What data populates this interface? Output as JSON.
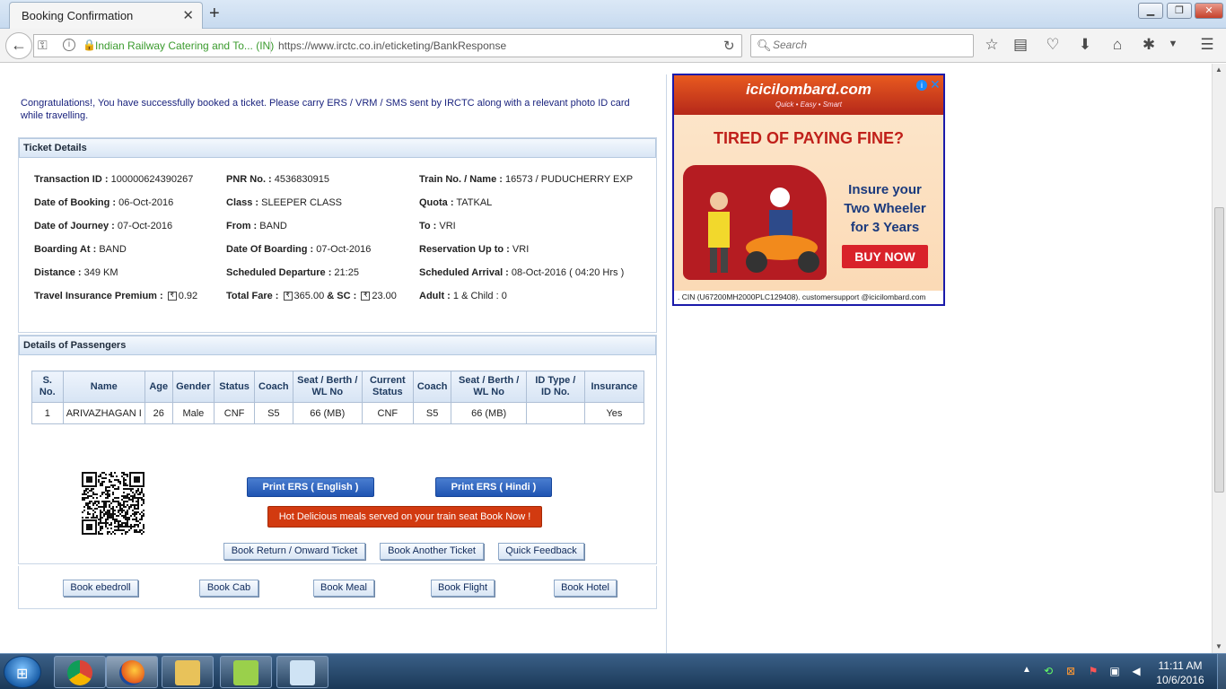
{
  "browser": {
    "tab_title": "Booking Confirmation",
    "site_identity": "Indian Railway Catering and To... (IN)",
    "url": "https://www.irctc.co.in/eticketing/BankResponse",
    "search_placeholder": "Search"
  },
  "page": {
    "congrats_message": "Congratulations!, You have successfully booked a ticket. Please carry ERS / VRM / SMS sent by IRCTC along with a relevant photo ID card while travelling.",
    "ticket_section_title": "Ticket Details",
    "passengers_section_title": "Details of Passengers"
  },
  "ticket": {
    "transaction_id_label": "Transaction ID :",
    "transaction_id": "100000624390267",
    "pnr_label": "PNR No. :",
    "pnr": "4536830915",
    "train_label": "Train No. / Name :",
    "train": "16573 / PUDUCHERRY EXP",
    "booking_date_label": "Date of Booking :",
    "booking_date": "06-Oct-2016",
    "class_label": "Class :",
    "class": "SLEEPER CLASS",
    "quota_label": "Quota :",
    "quota": "TATKAL",
    "journey_date_label": "Date of Journey :",
    "journey_date": "07-Oct-2016",
    "from_label": "From :",
    "from": "BAND",
    "to_label": "To :",
    "to": "VRI",
    "boarding_at_label": "Boarding At :",
    "boarding_at": "BAND",
    "boarding_date_label": "Date Of Boarding :",
    "boarding_date": "07-Oct-2016",
    "reservation_upto_label": "Reservation Up to :",
    "reservation_upto": "VRI",
    "distance_label": "Distance :",
    "distance": "349 KM",
    "sched_departure_label": "Scheduled Departure :",
    "sched_departure": "21:25",
    "sched_arrival_label": "Scheduled Arrival :",
    "sched_arrival": "08-Oct-2016 ( 04:20 Hrs )",
    "insurance_label": "Travel Insurance Premium :",
    "insurance": "0.92",
    "fare_label": "Total Fare :",
    "fare": "365.00",
    "sc_label": "& SC :",
    "sc": "23.00",
    "pax_count_label": "Adult :",
    "pax_count": "1 & Child : 0"
  },
  "passenger_table": {
    "headers": [
      "S. No.",
      "Name",
      "Age",
      "Gender",
      "Status",
      "Coach",
      "Seat / Berth / WL No",
      "Current Status",
      "Coach",
      "Seat / Berth / WL No",
      "ID Type / ID No.",
      "Insurance"
    ],
    "rows": [
      [
        "1",
        "ARIVAZHAGAN I",
        "26",
        "Male",
        "CNF",
        "S5",
        "66 (MB)",
        "CNF",
        "S5",
        "66 (MB)",
        "",
        "Yes"
      ]
    ]
  },
  "actions": {
    "print_english": "Print ERS ( English )",
    "print_hindi": "Print ERS ( Hindi )",
    "meal_promo": "Hot Delicious meals served on your train seat Book Now !",
    "book_return": "Book Return / Onward Ticket",
    "book_another": "Book Another Ticket",
    "quick_feedback": "Quick Feedback",
    "book_ebedroll": "Book ebedroll",
    "book_cab": "Book Cab",
    "book_meal": "Book Meal",
    "book_flight": "Book Flight",
    "book_hotel": "Book Hotel"
  },
  "ad": {
    "brand": "icicilombard.com",
    "tagline": "Quick • Easy • Smart",
    "headline": "TIRED OF PAYING FINE?",
    "body": "Insure your Two Wheeler for 3 Years",
    "cta": "BUY NOW",
    "footer": ". CIN (U67200MH2000PLC129408). customersupport @icicilombard.com"
  },
  "taskbar": {
    "time": "11:11 AM",
    "date": "10/6/2016"
  }
}
